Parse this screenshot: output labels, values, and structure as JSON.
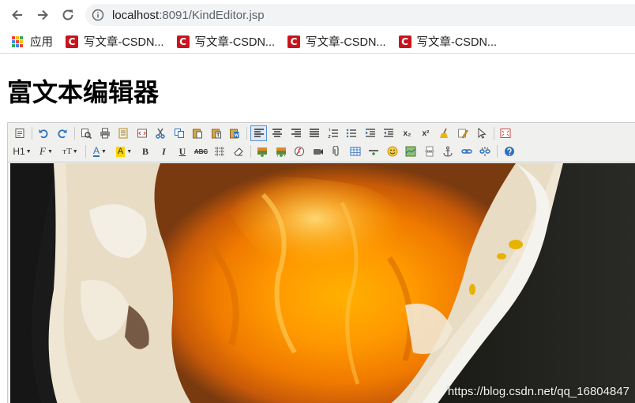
{
  "browser": {
    "url_host": "localhost",
    "url_rest": ":8091/KindEditor.jsp",
    "bookmarks": [
      {
        "label": "应用",
        "icon": "apps-icon"
      },
      {
        "label": "写文章-CSDN...",
        "icon": "csdn-icon"
      },
      {
        "label": "写文章-CSDN...",
        "icon": "csdn-icon"
      },
      {
        "label": "写文章-CSDN...",
        "icon": "csdn-icon"
      },
      {
        "label": "写文章-CSDN...",
        "icon": "csdn-icon"
      }
    ],
    "csdn_letter": "C"
  },
  "page": {
    "title": "富文本编辑器"
  },
  "toolbar": {
    "heading_label": "H1",
    "font_label": "F",
    "size_label": "тT",
    "bold_label": "B",
    "italic_label": "I",
    "underline_label": "U",
    "abc_label": "ABC",
    "subscript_label": "x₂",
    "superscript_label": "x²",
    "font_color_label": "A",
    "highlight_label": "A"
  },
  "editor": {
    "watermark": "https://blog.csdn.net/qq_16804847"
  },
  "colors": {
    "csdn_red": "#c8151d",
    "toolbar_bg": "#f0f0ee",
    "active_border": "#5690d2",
    "icon_blue": "#2c6fbf",
    "omnibox_bg": "#f1f3f4"
  }
}
